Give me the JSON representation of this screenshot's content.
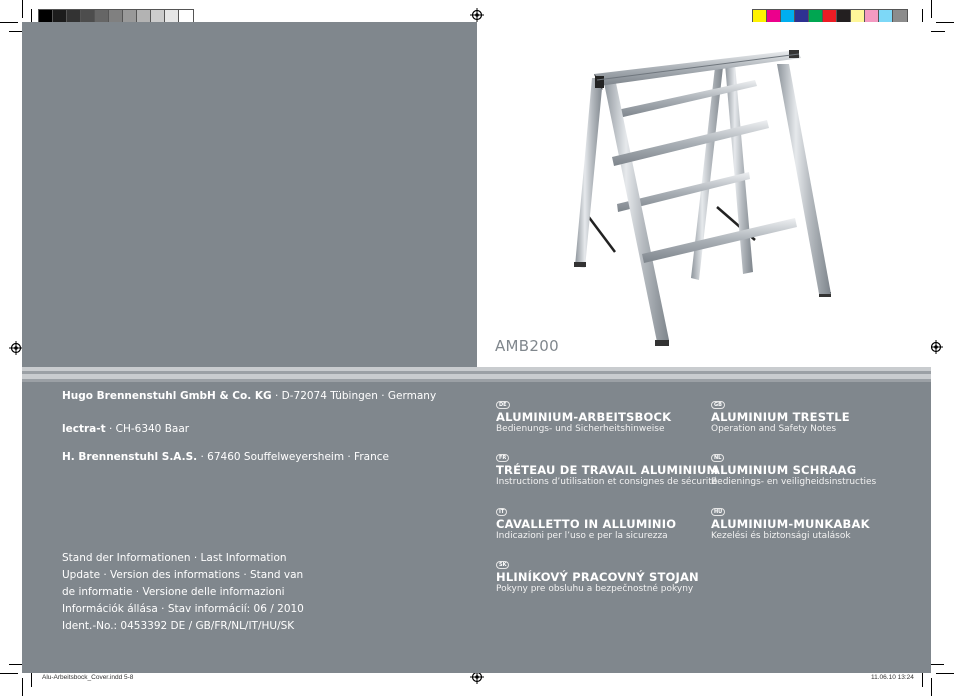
{
  "color_bars": {
    "grayscale": [
      "#000000",
      "#1c1c1c",
      "#333333",
      "#4d4d4d",
      "#666666",
      "#808080",
      "#999999",
      "#b3b3b3",
      "#cccccc",
      "#e6e6e6",
      "#ffffff"
    ],
    "process": [
      "#fff200",
      "#ec008c",
      "#00aeef",
      "#2e3192",
      "#00a651",
      "#ed1c24",
      "#231f20",
      "#fff799",
      "#f49ac1",
      "#7dd8f7",
      "#8c8c8c"
    ]
  },
  "product": {
    "model": "AMB200",
    "image_alt": "aluminium-trestle-image"
  },
  "colors": {
    "panel_gray": "#80878d",
    "text_white": "#ffffff"
  },
  "companies": [
    {
      "name": "Hugo Brennenstuhl GmbH & Co. KG",
      "address": " · D-72074 Tübingen · Germany"
    },
    {
      "name": "lectra-t",
      "address": " · CH-6340 Baar"
    },
    {
      "name": "H. Brennenstuhl S.A.S.",
      "address": " · 67460 Souffelweyersheim · France"
    }
  ],
  "info_lines": [
    "Stand der Informationen · Last Information",
    "Update · Version des informations · Stand van",
    "de informatie · Versione delle informazioni",
    "Információk állása · Stav informácií: 06 / 2010",
    "Ident.-No.: 0453392 DE / GB/FR/NL/IT/HU/SK"
  ],
  "languages": [
    {
      "code": "DE",
      "title": "ALUMINIUM-ARBEITSBOCK",
      "subtitle": "Bedienungs- und Sicherheitshinweise"
    },
    {
      "code": "FR",
      "title": "TRÉTEAU DE TRAVAIL ALUMINIUM",
      "subtitle": "Instructions d’utilisation et consignes de sécurité"
    },
    {
      "code": "IT",
      "title": "CAVALLETTO IN ALLUMINIO",
      "subtitle": "Indicazioni per l’uso e per la sicurezza"
    },
    {
      "code": "SK",
      "title": "HLINÍKOVÝ PRACOVNÝ STOJAN",
      "subtitle": "Pokyny pre obsluhu a bezpečnostné pokyny"
    },
    {
      "code": "GB",
      "title": "ALUMINIUM TRESTLE",
      "subtitle": "Operation and Safety Notes"
    },
    {
      "code": "NL",
      "title": "ALUMINIUM SCHRAAG",
      "subtitle": "Bedienings- en veiligheidsinstructies"
    },
    {
      "code": "HU",
      "title": "ALUMINIUM-MUNKABAK",
      "subtitle": "Kezelési és biztonsági utalások"
    }
  ],
  "slug": {
    "filename": "Alu-Arbeitsbock_Cover.indd   5-8",
    "datetime": "11.06.10   13:24"
  }
}
